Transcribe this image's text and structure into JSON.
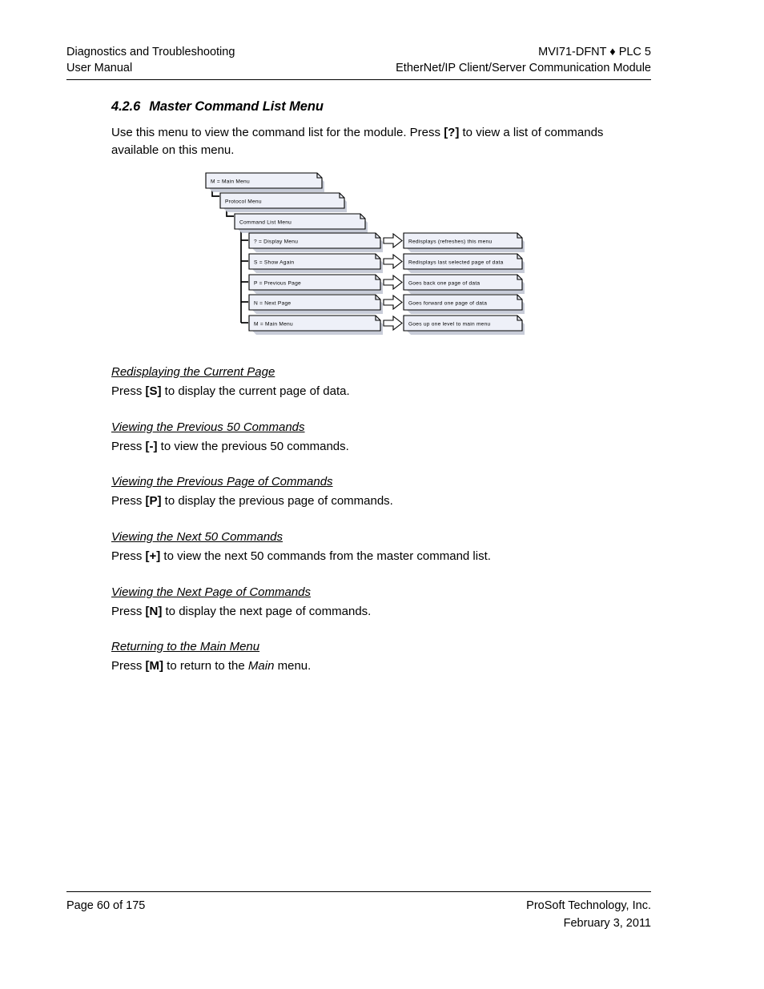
{
  "header": {
    "left_line1": "Diagnostics and Troubleshooting",
    "left_line2": "User Manual",
    "right_line1": "MVI71-DFNT ♦ PLC 5",
    "right_line2": "EtherNet/IP Client/Server Communication Module"
  },
  "section": {
    "number": "4.2.6",
    "title": "Master Command List Menu",
    "intro_before": "Use this menu to view the command list for the module. Press ",
    "intro_key": "[?]",
    "intro_after": " to view a list of commands available on this menu."
  },
  "diagram": {
    "breadcrumb": [
      {
        "label": "M = Main Menu"
      },
      {
        "label": "Protocol Menu"
      },
      {
        "label": "Command List Menu"
      }
    ],
    "options": [
      {
        "key": "? = Display Menu",
        "description": "Redisplays (refreshes) this menu"
      },
      {
        "key": "S = Show Again",
        "description": "Redisplays last selected page of data"
      },
      {
        "key": "P = Previous Page",
        "description": "Goes back one page of data"
      },
      {
        "key": "N = Next Page",
        "description": "Goes forward one page of data"
      },
      {
        "key": "M = Main Menu",
        "description": "Goes up one level to main menu"
      }
    ],
    "colors": {
      "box_fill": "#eef0f8",
      "box_stroke": "#000000",
      "shadow": "#c8ccd8",
      "arrow_fill": "#ffffff"
    }
  },
  "subsections": [
    {
      "title": "Redisplaying the Current Page",
      "body_before": "Press ",
      "key": "[S]",
      "body_after": " to display the current page of data."
    },
    {
      "title": "Viewing the Previous 50 Commands",
      "body_before": "Press ",
      "key": "[-]",
      "body_after": " to view the previous 50 commands."
    },
    {
      "title": "Viewing the Previous Page of Commands",
      "body_before": "Press ",
      "key": "[P]",
      "body_after": " to display the previous page of commands."
    },
    {
      "title": "Viewing the Next 50 Commands",
      "body_before": "Press ",
      "key": "[+]",
      "body_after": " to view the next 50 commands from the master command list."
    },
    {
      "title": "Viewing the Next Page of Commands",
      "body_before": "Press ",
      "key": "[N]",
      "body_after": " to display the next page of commands."
    },
    {
      "title": "Returning to the Main Menu",
      "body_before": "Press ",
      "key": "[M]",
      "body_after_1": " to return to the ",
      "emphasis": "Main",
      "body_after_2": " menu."
    }
  ],
  "footer": {
    "left": "Page 60 of 175",
    "right_line1": "ProSoft Technology, Inc.",
    "right_line2": "February 3, 2011"
  }
}
